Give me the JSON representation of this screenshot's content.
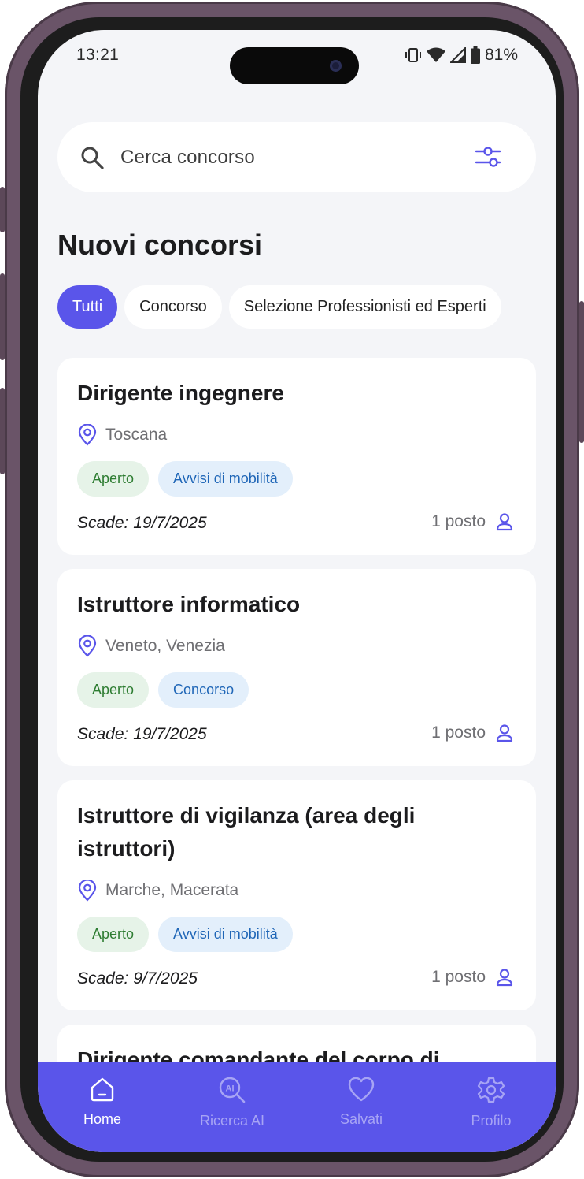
{
  "status_bar": {
    "time": "13:21",
    "battery": "81%"
  },
  "search": {
    "placeholder": "Cerca concorso"
  },
  "section": {
    "title": "Nuovi concorsi"
  },
  "chips": [
    {
      "label": "Tutti",
      "active": true
    },
    {
      "label": "Concorso",
      "active": false
    },
    {
      "label": "Selezione Professionisti ed Esperti",
      "active": false
    }
  ],
  "cards": [
    {
      "title": "Dirigente ingegnere",
      "location": "Toscana",
      "status": "Aperto",
      "type": "Avvisi di mobilità",
      "deadline": "Scade: 19/7/2025",
      "posts": "1 posto"
    },
    {
      "title": "Istruttore informatico",
      "location": "Veneto, Venezia",
      "status": "Aperto",
      "type": "Concorso",
      "deadline": "Scade: 19/7/2025",
      "posts": "1 posto"
    },
    {
      "title": "Istruttore di vigilanza (area degli istruttori)",
      "location": "Marche, Macerata",
      "status": "Aperto",
      "type": "Avvisi di mobilità",
      "deadline": "Scade: 9/7/2025",
      "posts": "1 posto"
    },
    {
      "title": "Dirigente comandante del corpo di"
    }
  ],
  "nav": [
    {
      "label": "Home",
      "icon": "home-icon",
      "active": true
    },
    {
      "label": "Ricerca AI",
      "icon": "ai-search-icon",
      "active": false
    },
    {
      "label": "Salvati",
      "icon": "heart-icon",
      "active": false
    },
    {
      "label": "Profilo",
      "icon": "gear-icon",
      "active": false
    }
  ],
  "colors": {
    "accent": "#5a55ea",
    "open_tag_bg": "#e6f3e8",
    "open_tag_text": "#2e7d32",
    "type_tag_bg": "#e3effb",
    "type_tag_text": "#1f66b7",
    "screen_bg": "#f4f5f8"
  }
}
